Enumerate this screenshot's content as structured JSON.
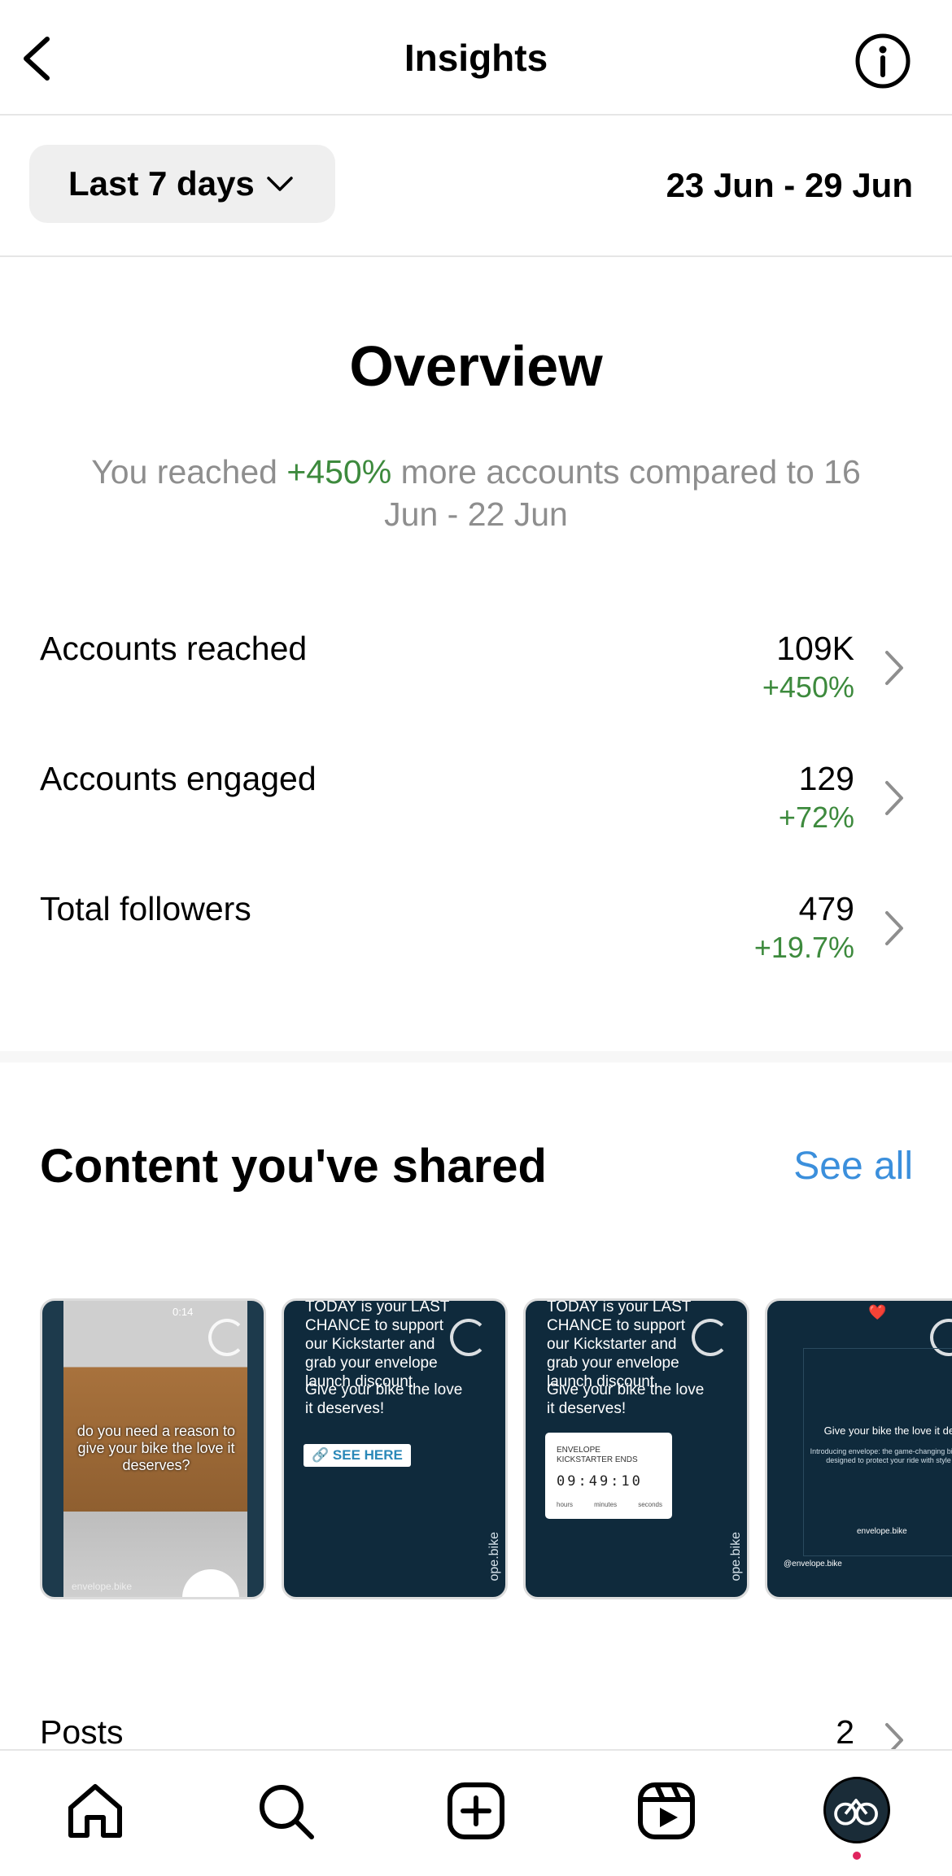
{
  "header": {
    "title": "Insights"
  },
  "filter": {
    "range_label": "Last 7 days",
    "date_range": "23 Jun - 29 Jun"
  },
  "overview": {
    "title": "Overview",
    "sub_prefix": "You reached ",
    "sub_pct": "+450%",
    "sub_suffix": " more accounts compared to 16 Jun - 22 Jun"
  },
  "metrics": [
    {
      "label": "Accounts reached",
      "value": "109K",
      "change": "+450%"
    },
    {
      "label": "Accounts engaged",
      "value": "129",
      "change": "+72%"
    },
    {
      "label": "Total followers",
      "value": "479",
      "change": "+19.7%"
    }
  ],
  "content": {
    "title": "Content you've shared",
    "see_all": "See all",
    "thumbs": [
      {
        "duration": "0:14",
        "overlay": "do you need a reason to give your bike the love it deserves?",
        "handle": "envelope.bike"
      },
      {
        "text1": "TODAY is your LAST CHANCE to support our Kickstarter and grab your envelope launch discount",
        "text2": "Give your bike the love it deserves!",
        "button": "SEE HERE",
        "side": "ope.bike"
      },
      {
        "text1": "TODAY is your LAST CHANCE to support our Kickstarter and grab your envelope launch discount",
        "text2": "Give your bike the love it deserves!",
        "countdown_title": "ENVELOPE KICKSTARTER ENDS",
        "countdown_digits": "09:49:10",
        "units": [
          "hours",
          "minutes",
          "seconds"
        ],
        "side": "ope.bike"
      },
      {
        "emoji": "❤️",
        "text1": "Give your bike the love it deserves",
        "text2": "Introducing envelope: the game-changing bike cover range designed to protect your ride with style and ease.",
        "brand": "envelope.bike",
        "handle": "@envelope.bike"
      }
    ]
  },
  "posts": {
    "label": "Posts",
    "value": "2"
  },
  "colors": {
    "positive": "#3d8a3d",
    "link": "#3b8fdc",
    "muted": "#8e8e8e",
    "thumb_bg": "#0f2a3c"
  },
  "icons": [
    "back-arrow-icon",
    "info-icon",
    "chevron-down-icon",
    "chevron-right-icon",
    "home-icon",
    "search-icon",
    "create-icon",
    "reels-icon",
    "profile-avatar"
  ]
}
